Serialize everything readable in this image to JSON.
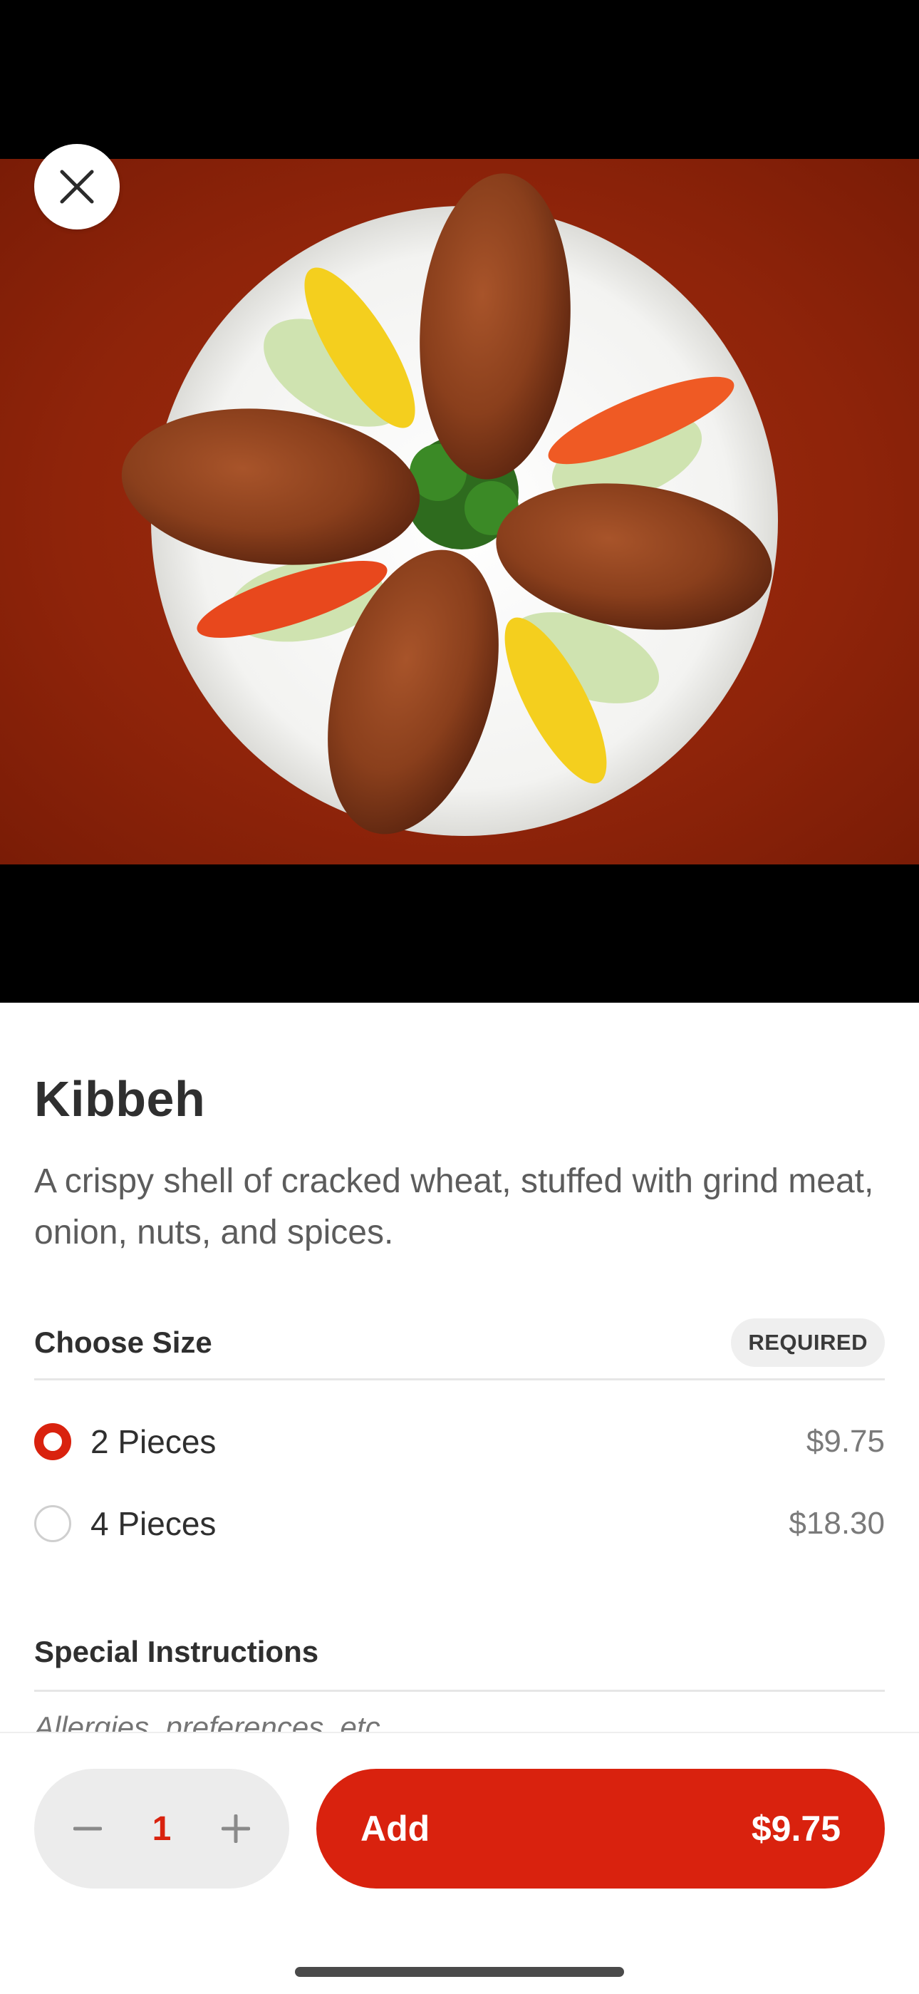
{
  "item": {
    "title": "Kibbeh",
    "description": "A crispy shell of cracked wheat, stuffed with grind meat, onion, nuts, and spices."
  },
  "size_section": {
    "title": "Choose Size",
    "badge": "REQUIRED",
    "options": [
      {
        "label": "2 Pieces",
        "price": "$9.75",
        "selected": true
      },
      {
        "label": "4 Pieces",
        "price": "$18.30",
        "selected": false
      }
    ]
  },
  "instructions_section": {
    "title": "Special Instructions",
    "placeholder": "Allergies, preferences, etc."
  },
  "cart": {
    "quantity": "1",
    "add_label": "Add",
    "add_price": "$9.75"
  },
  "icons": {
    "close": "close-icon",
    "minus": "minus-icon",
    "plus": "plus-icon"
  },
  "colors": {
    "accent": "#d9220e",
    "hero_background": "#8f240a"
  }
}
